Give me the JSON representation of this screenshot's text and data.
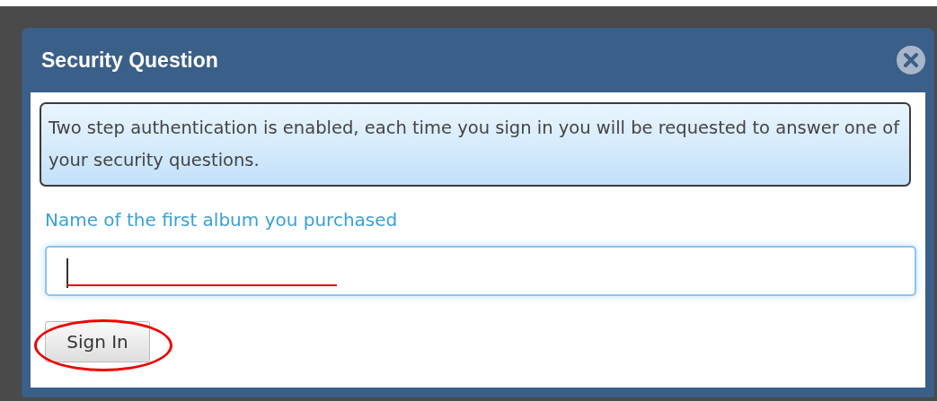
{
  "dialog": {
    "title": "Security Question",
    "notice": "Two step authentication is enabled, each time you sign in you will be requested to answer one of your security questions.",
    "question_label": "Name of the first album you purchased",
    "answer_field": {
      "focused": true
    },
    "buttons": [
      {
        "label": "Sign In",
        "highlighted": true
      }
    ]
  }
}
